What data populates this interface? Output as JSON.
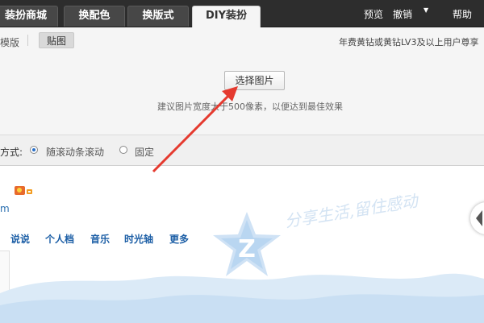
{
  "tabs": [
    "装扮商城",
    "换配色",
    "换版式",
    "DIY装扮"
  ],
  "top_links": {
    "preview": "预览",
    "undo": "撤销",
    "help": "帮助"
  },
  "subtabs": {
    "template": "模版",
    "sticker": "贴图"
  },
  "notice": "年费黄钻或黄钻LV3及以上用户尊享",
  "upload": {
    "choose_button": "选择图片",
    "hint": "建议图片宽度大于500像素，以便达到最佳效果"
  },
  "scroll_mode": {
    "label": "方式:",
    "options": [
      "随滚动条滚动",
      "固定"
    ],
    "selected": 0
  },
  "preview": {
    "domain_fragment": "m",
    "nav_items": [
      "说说",
      "个人档",
      "音乐",
      "时光轴",
      "更多"
    ],
    "slogan": "分享生活,留住感动"
  },
  "colors": {
    "topbar": "#2d2d2d",
    "annotation_arrow": "#e53a2f",
    "nav_link": "#1d5fa6"
  }
}
